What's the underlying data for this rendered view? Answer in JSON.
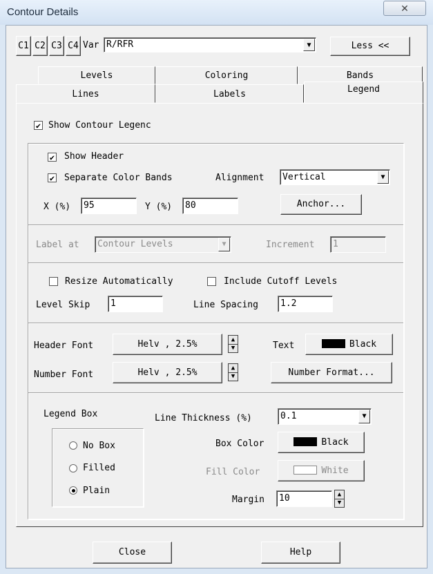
{
  "window": {
    "title": "Contour Details",
    "close_glyph": "✕"
  },
  "top": {
    "contour_buttons": [
      "C1",
      "C2",
      "C3",
      "C4"
    ],
    "var_label": "Var",
    "var_value": "R/RFR",
    "less_button": "Less <<"
  },
  "tabs": {
    "row_back": [
      "Levels",
      "Coloring",
      "Bands"
    ],
    "row_front": [
      "Lines",
      "Labels",
      "Legend"
    ],
    "active": "Legend"
  },
  "legend": {
    "show_contour_legend": {
      "label": "Show Contour Legenc",
      "checked": true
    },
    "show_header": {
      "label": "Show Header",
      "checked": true
    },
    "separate_color_bands": {
      "label": "Separate Color Bands",
      "checked": true
    },
    "alignment_label": "Alignment",
    "alignment_value": "Vertical",
    "x_label": "X (%)",
    "x_value": "95",
    "y_label": "Y (%)",
    "y_value": "80",
    "anchor_button": "Anchor...",
    "label_at_label": "Label at",
    "label_at_value": "Contour Levels",
    "increment_label": "Increment",
    "increment_value": "1",
    "resize_auto": {
      "label": "Resize Automatically",
      "checked": false
    },
    "include_cutoff": {
      "label": "Include Cutoff Levels",
      "checked": false
    },
    "level_skip_label": "Level Skip",
    "level_skip_value": "1",
    "line_spacing_label": "Line Spacing",
    "line_spacing_value": "1.2",
    "header_font_label": "Header Font",
    "header_font_value": "Helv , 2.5%",
    "number_font_label": "Number Font",
    "number_font_value": "Helv , 2.5%",
    "text_label": "Text",
    "text_color": {
      "name": "Black",
      "hex": "#000000"
    },
    "number_format_button": "Number Format...",
    "legend_box_label": "Legend Box",
    "box_options": [
      {
        "label": "No Box",
        "selected": false
      },
      {
        "label": "Filled",
        "selected": false
      },
      {
        "label": "Plain",
        "selected": true
      }
    ],
    "line_thickness_label": "Line Thickness (%)",
    "line_thickness_value": "0.1",
    "box_color_label": "Box Color",
    "box_color": {
      "name": "Black",
      "hex": "#000000"
    },
    "fill_color_label": "Fill Color",
    "fill_color": {
      "name": "White",
      "hex": "#ffffff"
    },
    "margin_label": "Margin",
    "margin_value": "10"
  },
  "footer": {
    "close_button": "Close",
    "help_button": "Help"
  },
  "icons": {
    "dropdown": "▼",
    "check": "✔",
    "spin_up": "▲",
    "spin_down": "▼"
  }
}
